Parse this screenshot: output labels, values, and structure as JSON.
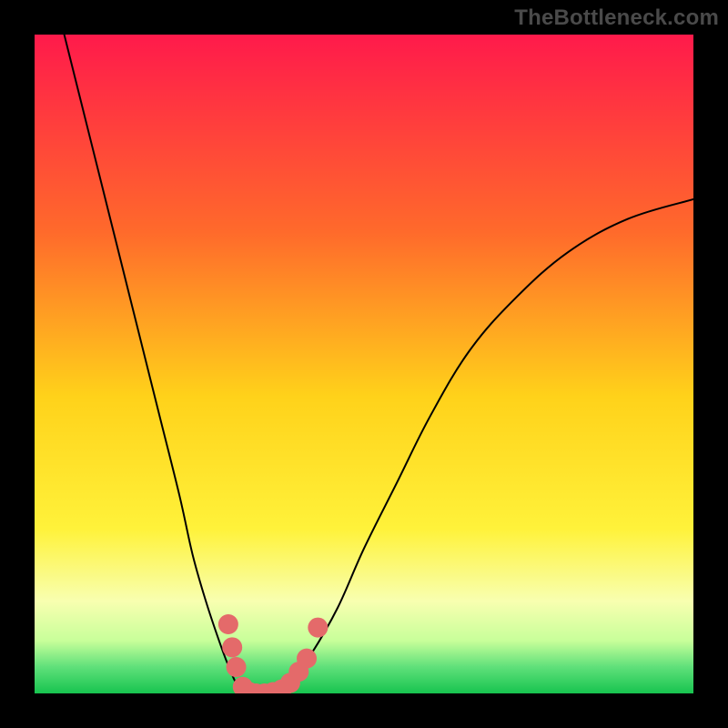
{
  "attribution": "TheBottleneck.com",
  "chart_data": {
    "type": "line",
    "title": "",
    "xlabel": "",
    "ylabel": "",
    "xlim": [
      0,
      100
    ],
    "ylim": [
      0,
      100
    ],
    "background_gradient": [
      {
        "offset": 0.0,
        "color": "#ff1a4b"
      },
      {
        "offset": 0.3,
        "color": "#ff6a2b"
      },
      {
        "offset": 0.55,
        "color": "#ffd21a"
      },
      {
        "offset": 0.75,
        "color": "#fff23a"
      },
      {
        "offset": 0.86,
        "color": "#f8ffb0"
      },
      {
        "offset": 0.92,
        "color": "#c8ff9a"
      },
      {
        "offset": 0.96,
        "color": "#5fe07a"
      },
      {
        "offset": 1.0,
        "color": "#17c44f"
      }
    ],
    "series": [
      {
        "name": "left-branch",
        "stroke": "#000000",
        "stroke_width": 2,
        "x": [
          4.5,
          7,
          10,
          13,
          16,
          19,
          22,
          24,
          26,
          28,
          29.5,
          31,
          33
        ],
        "y": [
          100,
          90,
          78,
          66,
          54,
          42,
          30,
          21,
          14,
          8,
          4,
          1,
          0
        ]
      },
      {
        "name": "right-branch",
        "stroke": "#000000",
        "stroke_width": 2,
        "x": [
          36,
          39,
          42,
          46,
          50,
          55,
          60,
          66,
          73,
          81,
          90,
          100
        ],
        "y": [
          0,
          2,
          6,
          13,
          22,
          32,
          42,
          52,
          60,
          67,
          72,
          75
        ]
      }
    ],
    "markers": {
      "name": "highlight-dots",
      "color": "#e46a6a",
      "radius": 11,
      "points": [
        {
          "x": 29.4,
          "y": 10.5
        },
        {
          "x": 30.0,
          "y": 7.0
        },
        {
          "x": 30.6,
          "y": 4.0
        },
        {
          "x": 31.6,
          "y": 1.0
        },
        {
          "x": 32.6,
          "y": 0.2
        },
        {
          "x": 33.6,
          "y": 0.0
        },
        {
          "x": 34.9,
          "y": 0.0
        },
        {
          "x": 36.2,
          "y": 0.2
        },
        {
          "x": 37.5,
          "y": 0.6
        },
        {
          "x": 38.8,
          "y": 1.6
        },
        {
          "x": 40.1,
          "y": 3.3
        },
        {
          "x": 41.3,
          "y": 5.3
        },
        {
          "x": 43.0,
          "y": 10.0
        }
      ]
    }
  }
}
